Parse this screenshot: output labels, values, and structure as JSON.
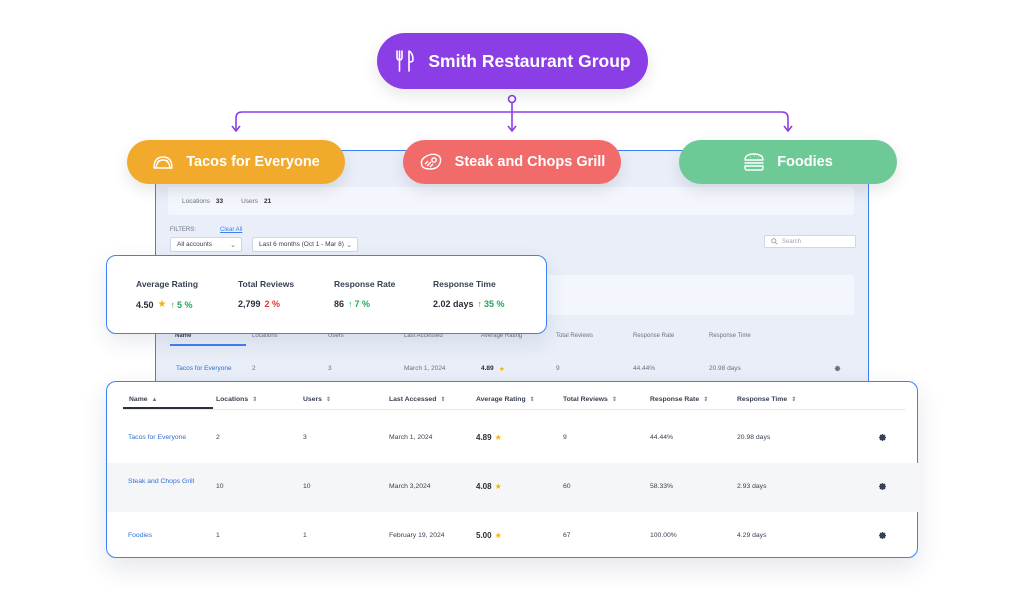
{
  "org": {
    "name": "Smith Restaurant Group",
    "icon": "utensils-icon",
    "color": "#8b3ee6"
  },
  "brands": [
    {
      "name": "Tacos for Everyone",
      "icon": "taco-icon",
      "color": "#f1aa2c"
    },
    {
      "name": "Steak and Chops Grill",
      "icon": "steak-icon",
      "color": "#f26b6b"
    },
    {
      "name": "Foodies",
      "icon": "burger-icon",
      "color": "#6dc996"
    }
  ],
  "bg_dashboard": {
    "locations_label": "Locations",
    "locations_value": "33",
    "users_label": "Users",
    "users_value": "21",
    "filters_label": "FILTERS:",
    "clear_all": "Clear All",
    "account_select": "All accounts",
    "date_select": "Last 6 months (Oct 1 - Mar 8)",
    "search_placeholder": "Search",
    "columns": [
      "Name",
      "Locations",
      "Users",
      "Last Accessed",
      "Average Rating",
      "Total Reviews",
      "Response Rate",
      "Response Time"
    ],
    "row": {
      "name": "Tacos for Everyone",
      "locations": "2",
      "users": "3",
      "last_accessed": "March 1, 2024",
      "rating": "4.89",
      "reviews": "9",
      "response_rate": "44.44%",
      "response_time": "20.98 days"
    }
  },
  "metrics": {
    "average_rating": {
      "label": "Average Rating",
      "value": "4.50",
      "change": "5 %",
      "direction": "up"
    },
    "total_reviews": {
      "label": "Total Reviews",
      "value": "2,799",
      "change": "2 %",
      "direction": "down"
    },
    "response_rate": {
      "label": "Response Rate",
      "value": "86",
      "change": "7 %",
      "direction": "up"
    },
    "response_time": {
      "label": "Response Time",
      "value": "2.02 days",
      "change": "35 %",
      "direction": "up"
    }
  },
  "table": {
    "columns": {
      "name": "Name",
      "locations": "Locations",
      "users": "Users",
      "last_accessed": "Last Accessed",
      "average_rating": "Average Rating",
      "total_reviews": "Total Reviews",
      "response_rate": "Response Rate",
      "response_time": "Response Time"
    },
    "rows": [
      {
        "name": "Tacos for Everyone",
        "locations": "2",
        "users": "3",
        "last_accessed": "March 1, 2024",
        "rating": "4.89",
        "reviews": "9",
        "response_rate": "44.44%",
        "response_time": "20.98 days"
      },
      {
        "name": "Steak and Chops Grill",
        "locations": "10",
        "users": "10",
        "last_accessed": "March 3,2024",
        "rating": "4.08",
        "reviews": "60",
        "response_rate": "58.33%",
        "response_time": "2.93 days"
      },
      {
        "name": "Foodies",
        "locations": "1",
        "users": "1",
        "last_accessed": "February 19, 2024",
        "rating": "5.00",
        "reviews": "67",
        "response_rate": "100.00%",
        "response_time": "4.29 days"
      }
    ]
  }
}
